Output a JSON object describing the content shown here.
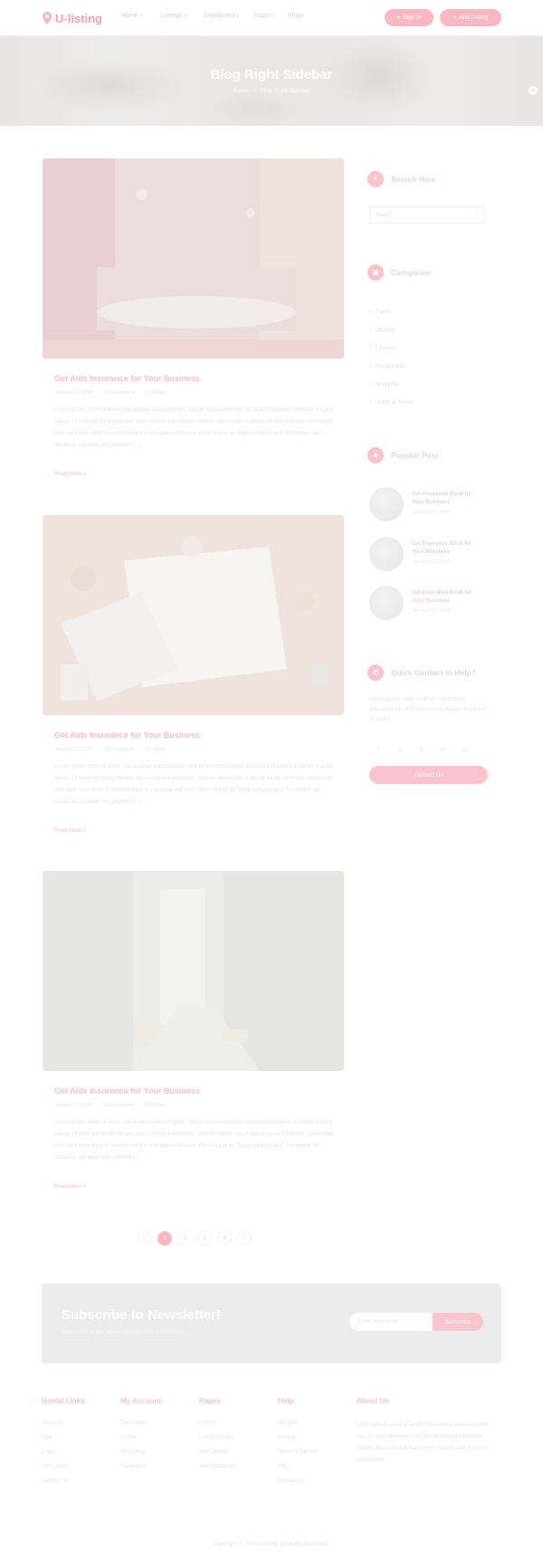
{
  "header": {
    "logo_text": "U-listing",
    "nav": [
      "Home",
      "Listings",
      "Dashboard",
      "Pages",
      "Blogs"
    ],
    "signin_label": "Sign In",
    "add_listing_label": "Add Listing"
  },
  "hero": {
    "title": "Blog Right Sidebar",
    "breadcrumb_home": "Home",
    "breadcrumb_current": "Blog Right Sidebar"
  },
  "posts": [
    {
      "title": "Get Aids Insurance for Your Business",
      "date": "January 12, 2024",
      "comments": "10 Comments",
      "views": "22 Views",
      "excerpt": "Lorem ipsum dolor sit amet, consectetur adipiscing elit, sed do eiusmod tempor incididunt ut labore et dolore magna aliqua. Ut enim ad minim veniam, quis nostrud exercitation ullamco laboris nisi ut aliquip ex ea commodo consequat. Duis aute irure dolor in reprehenderit in voluptate velit esse cillum dolore eu fugiat nulla pariatur. Excepteur sint occaecat cupidatat non proident [...]",
      "read_more": "Read More"
    },
    {
      "title": "Get Aids Insurance for Your Business",
      "date": "January 12, 2024",
      "comments": "10 Comments",
      "views": "22 Views",
      "excerpt": "Lorem ipsum dolor sit amet, consectetur adipiscing elit, sed do eiusmod tempor incididunt ut labore et dolore magna aliqua. Ut enim ad minim veniam, quis nostrud exercitation ullamco laboris nisi ut aliquip ex ea commodo consequat. Duis aute irure dolor in reprehenderit in voluptate velit esse cillum dolore eu fugiat nulla pariatur. Excepteur sint occaecat cupidatat non proident [...]",
      "read_more": "Read More"
    },
    {
      "title": "Get Aids Insurance for Your Business",
      "date": "January 12, 2024",
      "comments": "10 Comments",
      "views": "22 Views",
      "excerpt": "Lorem ipsum dolor sit amet, consectetur adipiscing elit, sed do eiusmod tempor incididunt ut labore et dolore magna aliqua. Ut enim ad minim veniam, quis nostrud exercitation ullamco laboris nisi ut aliquip ex ea commodo consequat. Duis aute irure dolor in reprehenderit in voluptate velit esse cillum dolore eu fugiat nulla pariatur. Excepteur sint occaecat cupidatat non proident [...]",
      "read_more": "Read More"
    }
  ],
  "sidebar": {
    "search": {
      "title": "Search Here",
      "placeholder": "Search..."
    },
    "categories": {
      "title": "Categories",
      "items": [
        "Travel",
        "Lifestyle",
        "Fashion",
        "Restaurants",
        "Shopping",
        "Hotels & Travel"
      ]
    },
    "popular": {
      "title": "Popular Post",
      "items": [
        {
          "title": "Get Insurance Book for Your Business",
          "date": "January 12, 2024"
        },
        {
          "title": "Get Insurance Book for Your Business",
          "date": "January 12, 2024"
        },
        {
          "title": "Get Insurance Book for Your Business",
          "date": "January 12, 2024"
        }
      ]
    },
    "contact": {
      "title": "Quick Contact to Help?",
      "text": "Lorem ipsum dolor sit amet, consectetur adipiscing elit, sed do eiusmod tempor incididunt ut labore.",
      "button": "Contact Us"
    }
  },
  "pagination": {
    "pages": [
      "1",
      "2",
      "3",
      "4"
    ]
  },
  "newsletter": {
    "title": "Subscribe to Newsletter!",
    "subtitle": "Subscribe to get latest updates and information.",
    "placeholder": "Enter your email",
    "button": "Subscribe"
  },
  "footer": {
    "columns": [
      {
        "title": "Useful Links",
        "items": [
          "About Us",
          "Blog",
          "Login",
          "Add Listing",
          "Contact Us"
        ]
      },
      {
        "title": "My Account",
        "items": [
          "Dashboard",
          "Profile",
          "My Listing",
          "Favourites"
        ]
      },
      {
        "title": "Pages",
        "items": [
          "Listing",
          "Listing Details",
          "Add Listings",
          "Add Restaurant"
        ]
      },
      {
        "title": "Help",
        "items": [
          "Support",
          "Privacy",
          "Terms of Service",
          "FAQ",
          "Contact Us"
        ]
      }
    ],
    "about_title": "About Us",
    "about_text": "Lorem ipsum dolor sit amet, consectetur adipiscing elit, sed do eiusmod tempor incididunt ut labore et dolore magna aliqua. Ut enim ad minim veniam, quis nostrud exercitation.",
    "copyright": "Copyright © 2024 U-listing. All Rights Reserved."
  }
}
